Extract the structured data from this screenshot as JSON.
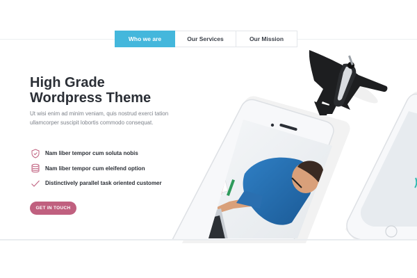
{
  "tabs": [
    {
      "label": "Who we are",
      "active": true
    },
    {
      "label": "Our Services",
      "active": false
    },
    {
      "label": "Our Mission",
      "active": false
    }
  ],
  "hero": {
    "title_line1": "High Grade",
    "title_line2": "Wordpress Theme",
    "description": "Ut wisi enim ad minim veniam, quis nostrud exerci tation ullamcorper suscipit lobortis commodo consequat."
  },
  "features": [
    {
      "icon": "shield-icon",
      "text": "Nam liber tempor cum soluta nobis"
    },
    {
      "icon": "database-icon",
      "text": "Nam liber tempor cum eleifend option"
    },
    {
      "icon": "checkmark-icon",
      "text": "Distinctively parallel task oriented customer"
    }
  ],
  "cta": {
    "label": "GET IN TOUCH"
  },
  "colors": {
    "accent": "#44b7dc",
    "button": "#c0607f",
    "icon": "#c0607f"
  }
}
